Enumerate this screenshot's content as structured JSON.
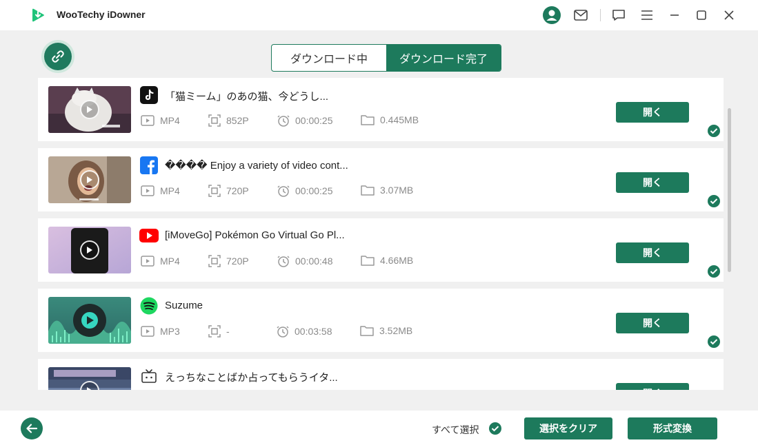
{
  "app": {
    "title": "WooTechy iDowner"
  },
  "titlebar": {
    "icons": [
      "user-icon",
      "mail-icon",
      "feedback-icon",
      "menu-icon",
      "minimize-icon",
      "maximize-icon",
      "close-icon"
    ]
  },
  "tabs": [
    {
      "label": "ダウンロード中",
      "active": false
    },
    {
      "label": "ダウンロード完了",
      "active": true
    }
  ],
  "items": [
    {
      "platform": "tiktok",
      "title": "「猫ミーム」のあの猫、今どうし...",
      "format": "MP4",
      "resolution": "852P",
      "duration": "00:00:25",
      "size": "0.445MB",
      "open_label": "開く",
      "checked": true
    },
    {
      "platform": "facebook",
      "title": "���� Enjoy a variety of video cont...",
      "format": "MP4",
      "resolution": "720P",
      "duration": "00:00:25",
      "size": "3.07MB",
      "open_label": "開く",
      "checked": true
    },
    {
      "platform": "youtube",
      "title": "[iMoveGo] Pokémon Go Virtual Go Pl...",
      "format": "MP4",
      "resolution": "720P",
      "duration": "00:00:48",
      "size": "4.66MB",
      "open_label": "開く",
      "checked": true
    },
    {
      "platform": "spotify",
      "title": "Suzume",
      "format": "MP3",
      "resolution": "-",
      "duration": "00:03:58",
      "size": "3.52MB",
      "open_label": "開く",
      "checked": true
    },
    {
      "platform": "niconico",
      "title": "えっちなことばか占ってもらうイタ...",
      "format": "",
      "resolution": "",
      "duration": "",
      "size": "",
      "open_label": "開く",
      "checked": false
    }
  ],
  "footer": {
    "select_all_label": "すべて選択",
    "clear_label": "選択をクリア",
    "convert_label": "形式変換"
  },
  "colors": {
    "accent": "#1d7a5c",
    "background": "#f0f0f0"
  }
}
